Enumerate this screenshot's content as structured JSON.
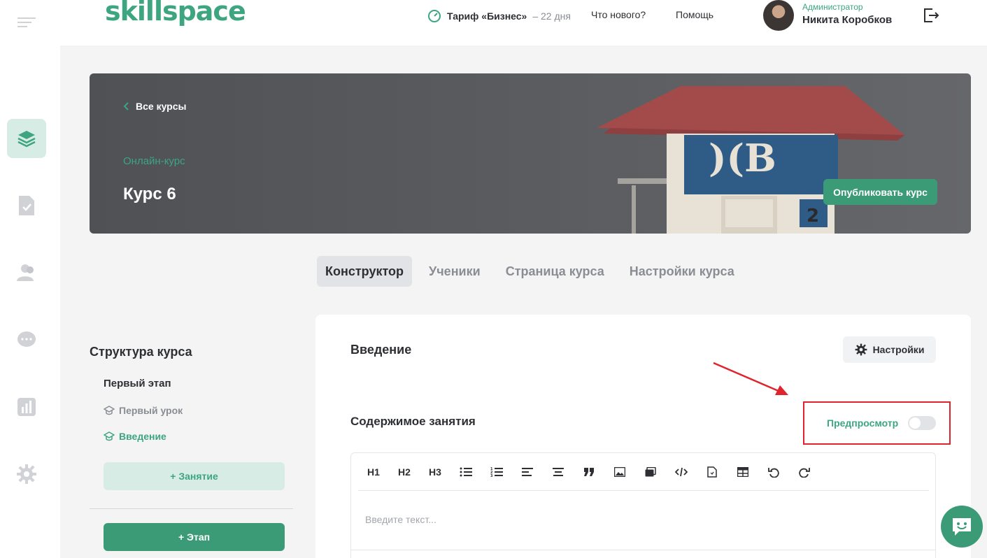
{
  "header": {
    "logo": "skillspace",
    "plan_label": "Тариф «Бизнес»",
    "plan_days": "– 22 дня",
    "whats_new": "Что нового?",
    "help": "Помощь",
    "user_role": "Администратор",
    "user_name": "Никита Коробков"
  },
  "sidebar": {
    "items": [
      {
        "icon": "courses-icon",
        "active": true
      },
      {
        "icon": "assignments-icon",
        "active": false
      },
      {
        "icon": "users-icon",
        "active": false
      },
      {
        "icon": "chat-icon",
        "active": false
      },
      {
        "icon": "analytics-icon",
        "active": false
      },
      {
        "icon": "gear-icon",
        "active": false
      }
    ]
  },
  "banner": {
    "back_label": "Все курсы",
    "course_type": "Онлайн-курс",
    "course_title": "Курс 6",
    "publish_label": "Опубликовать курс"
  },
  "tabs": [
    {
      "label": "Конструктор",
      "active": true
    },
    {
      "label": "Ученики",
      "active": false
    },
    {
      "label": "Страница курса",
      "active": false
    },
    {
      "label": "Настройки курса",
      "active": false
    }
  ],
  "structure": {
    "title": "Структура курса",
    "stage": "Первый этап",
    "lessons": [
      {
        "label": "Первый урок",
        "active": false
      },
      {
        "label": "Введение",
        "active": true
      }
    ],
    "add_lesson": "+ Занятие",
    "add_stage": "+ Этап"
  },
  "lesson": {
    "title": "Введение",
    "settings_label": "Настройки",
    "content_title": "Содержимое занятия",
    "preview_label": "Предпросмотр",
    "preview_enabled": false,
    "toolbar": [
      "H1",
      "H2",
      "H3"
    ],
    "toolbar_icons": [
      "bullet-list-icon",
      "numbered-list-icon",
      "align-left-icon",
      "align-center-icon",
      "quote-icon",
      "image-icon",
      "gallery-icon",
      "code-icon",
      "file-icon",
      "table-icon",
      "undo-icon",
      "redo-icon"
    ],
    "placeholder": "Введите текст..."
  },
  "colors": {
    "accent": "#3da57f",
    "accent_dark": "#3b9b76",
    "highlight": "#e0232c"
  }
}
